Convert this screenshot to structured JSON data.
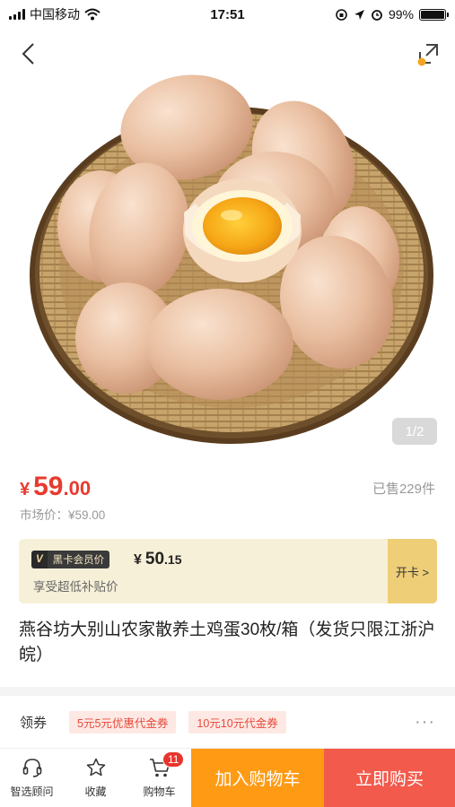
{
  "status_bar": {
    "carrier": "中国移动",
    "time": "17:51",
    "battery": "99%",
    "battery_level": 0.99
  },
  "hero": {
    "page_indicator": "1/2",
    "image_subject": "basket of brown eggs with one cracked egg showing yolk",
    "icons": {
      "back": "back-arrow-icon",
      "share": "share-expand-icon"
    }
  },
  "price": {
    "currency": "¥",
    "integer": "59",
    "decimal": ".00",
    "sold": "已售229件",
    "market": "市场价：¥59.00"
  },
  "member": {
    "badge_v": "V",
    "badge_text": "黑卡会员价",
    "currency": "¥",
    "integer": "50",
    "decimal": ".15",
    "subtitle": "享受超低补贴价",
    "open_label": "开卡 >"
  },
  "product": {
    "title": "燕谷坊大别山农家散养土鸡蛋30枚/箱（发货只限江浙沪皖）"
  },
  "coupons": {
    "label": "领券",
    "items": [
      "5元5元优惠代金券",
      "10元10元代金券"
    ],
    "more": "···"
  },
  "bottom_bar": {
    "advisor": "智选顾问",
    "favorite": "收藏",
    "cart": "购物车",
    "cart_count": "11",
    "add_to_cart": "加入购物车",
    "buy_now": "立即购买"
  },
  "colors": {
    "price_red": "#e83a2e",
    "cart_orange": "#ff9a14",
    "buy_red": "#f25a4c",
    "member_bg": "#f7f0d8",
    "member_open_bg": "#efce78"
  }
}
